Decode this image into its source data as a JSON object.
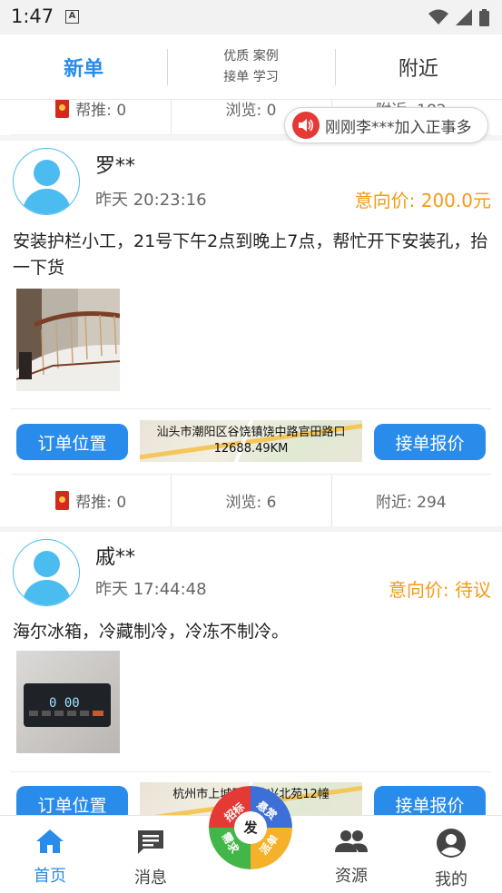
{
  "status_bar": {
    "time": "1:47",
    "notif_icon": "A"
  },
  "top_tabs": {
    "new_orders": "新单",
    "quality_line1": "优质 案例",
    "quality_line2": "接单 学习",
    "nearby": "附近"
  },
  "toast": {
    "text": "刚刚李***加入正事多"
  },
  "top_partial_stats": {
    "push": "帮推: 0",
    "views": "浏览: 0",
    "nearby": "附近: 182"
  },
  "orders": [
    {
      "name": "罗**",
      "time": "昨天 20:23:16",
      "price": "意向价: 200.0元",
      "description": "安装护栏小工，21号下午2点到晚上7点，帮忙开下安装孔，抬一下货",
      "location_button": "订单位置",
      "address": "汕头市潮阳区谷饶镇饶中路官田路口",
      "distance": "12688.49KM",
      "quote_button": "接单报价",
      "stats": {
        "push": "帮推: 0",
        "views": "浏览: 6",
        "nearby": "附近: 294"
      }
    },
    {
      "name": "戚**",
      "time": "昨天 17:44:48",
      "price": "意向价: 待议",
      "description": "海尔冰箱，冷藏制冷，冷冻不制冷。",
      "location_button": "订单位置",
      "address": "杭州市上城区彭埠兴北苑12幢",
      "quote_button": "接单报价",
      "fridge_display": "0  00"
    }
  ],
  "bottom_nav": {
    "home": "首页",
    "messages": "消息",
    "resources": "资源",
    "mine": "我的",
    "fab_center": "发",
    "fab_top_left": "招标",
    "fab_top_right": "悬赏",
    "fab_bottom_left": "需求",
    "fab_bottom_right": "派单"
  },
  "colors": {
    "accent_blue": "#2a8cea",
    "price_orange": "#f59a12",
    "avatar_blue": "#4bbcef",
    "toast_red": "#e53935"
  }
}
